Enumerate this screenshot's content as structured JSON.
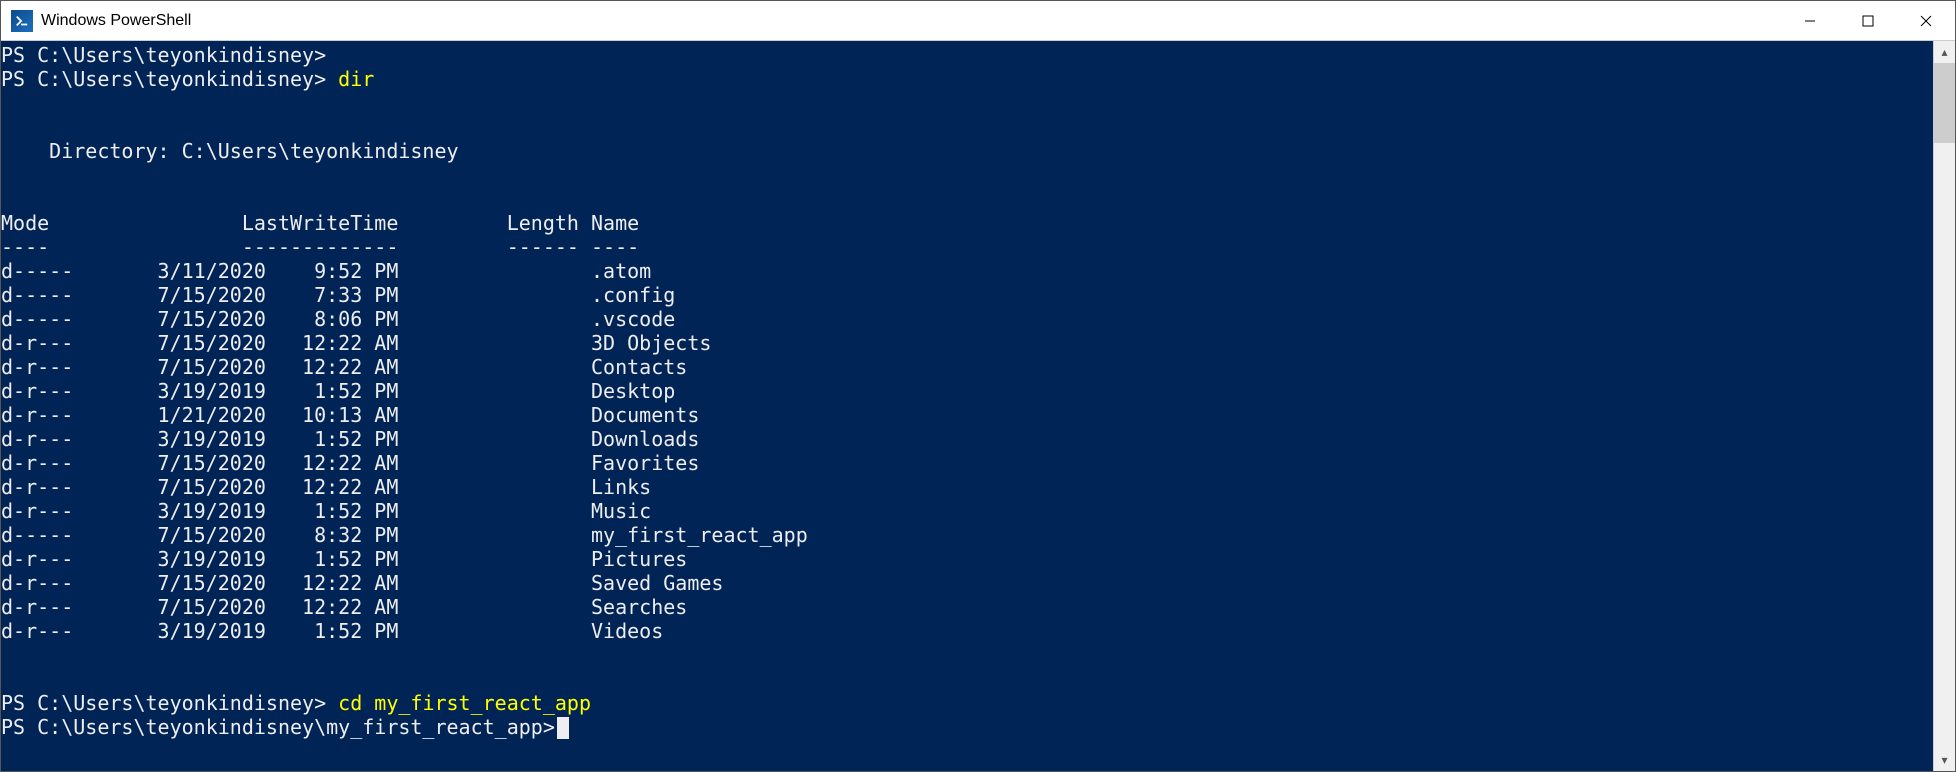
{
  "window": {
    "title": "Windows PowerShell"
  },
  "prompts": {
    "p1": "PS C:\\Users\\teyonkindisney>",
    "p2": "PS C:\\Users\\teyonkindisney>",
    "cmd2": " dir",
    "dirline": "    Directory: C:\\Users\\teyonkindisney",
    "header_line": "Mode                LastWriteTime         Length Name",
    "header_dashes": "----                -------------         ------ ----",
    "p3": "PS C:\\Users\\teyonkindisney>",
    "cmd3": " cd my_first_react_app",
    "p4": "PS C:\\Users\\teyonkindisney\\my_first_react_app>"
  },
  "listing": [
    {
      "mode": "d-----",
      "date": "3/11/2020",
      "time": "9:52 PM",
      "length": "",
      "name": ".atom"
    },
    {
      "mode": "d-----",
      "date": "7/15/2020",
      "time": "7:33 PM",
      "length": "",
      "name": ".config"
    },
    {
      "mode": "d-----",
      "date": "7/15/2020",
      "time": "8:06 PM",
      "length": "",
      "name": ".vscode"
    },
    {
      "mode": "d-r---",
      "date": "7/15/2020",
      "time": "12:22 AM",
      "length": "",
      "name": "3D Objects"
    },
    {
      "mode": "d-r---",
      "date": "7/15/2020",
      "time": "12:22 AM",
      "length": "",
      "name": "Contacts"
    },
    {
      "mode": "d-r---",
      "date": "3/19/2019",
      "time": "1:52 PM",
      "length": "",
      "name": "Desktop"
    },
    {
      "mode": "d-r---",
      "date": "1/21/2020",
      "time": "10:13 AM",
      "length": "",
      "name": "Documents"
    },
    {
      "mode": "d-r---",
      "date": "3/19/2019",
      "time": "1:52 PM",
      "length": "",
      "name": "Downloads"
    },
    {
      "mode": "d-r---",
      "date": "7/15/2020",
      "time": "12:22 AM",
      "length": "",
      "name": "Favorites"
    },
    {
      "mode": "d-r---",
      "date": "7/15/2020",
      "time": "12:22 AM",
      "length": "",
      "name": "Links"
    },
    {
      "mode": "d-r---",
      "date": "3/19/2019",
      "time": "1:52 PM",
      "length": "",
      "name": "Music"
    },
    {
      "mode": "d-----",
      "date": "7/15/2020",
      "time": "8:32 PM",
      "length": "",
      "name": "my_first_react_app"
    },
    {
      "mode": "d-r---",
      "date": "3/19/2019",
      "time": "1:52 PM",
      "length": "",
      "name": "Pictures"
    },
    {
      "mode": "d-r---",
      "date": "7/15/2020",
      "time": "12:22 AM",
      "length": "",
      "name": "Saved Games"
    },
    {
      "mode": "d-r---",
      "date": "7/15/2020",
      "time": "12:22 AM",
      "length": "",
      "name": "Searches"
    },
    {
      "mode": "d-r---",
      "date": "3/19/2019",
      "time": "1:52 PM",
      "length": "",
      "name": "Videos"
    }
  ]
}
